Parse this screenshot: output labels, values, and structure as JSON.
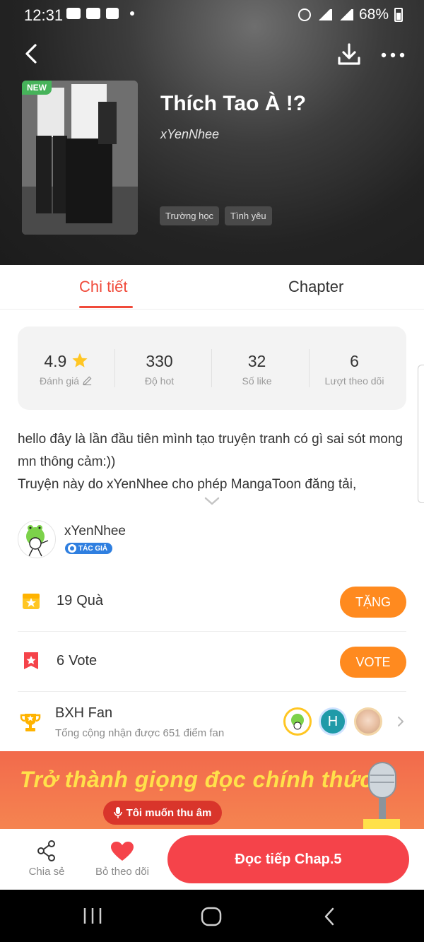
{
  "status_bar": {
    "time": "12:31",
    "battery": "68%"
  },
  "book": {
    "badge": "NEW",
    "title": "Thích Tao À !?",
    "author": "xYenNhee",
    "tags": [
      "Trường học",
      "Tình yêu"
    ]
  },
  "tabs": {
    "detail": "Chi tiết",
    "chapter": "Chapter"
  },
  "stats": [
    {
      "value": "4.9",
      "label": "Đánh giá"
    },
    {
      "value": "330",
      "label": "Độ hot"
    },
    {
      "value": "32",
      "label": "Số like"
    },
    {
      "value": "6",
      "label": "Lượt theo dõi"
    }
  ],
  "description": {
    "line1": "hello đây là lần đầu tiên mình tạo truyện tranh có gì sai sót mong mn thông cảm:))",
    "line2": "Truyện này do xYenNhee cho phép MangaToon đăng tải,"
  },
  "author_row": {
    "name": "xYenNhee",
    "badge": "TÁC GIẢ"
  },
  "gifts": {
    "count": "19",
    "label": "Quà",
    "button": "TẶNG"
  },
  "votes": {
    "count": "6",
    "label": "Vote",
    "button": "VOTE"
  },
  "fan_ranking": {
    "title": "BXH Fan",
    "subtitle": "Tổng cộng nhận được 651 điểm fan",
    "avatar_letter": "H"
  },
  "banner": {
    "headline": "Trở thành giọng đọc chính thức!",
    "button": "Tôi muốn thu âm"
  },
  "bottom_bar": {
    "share": "Chia sẻ",
    "unfollow": "Bỏ theo dõi",
    "read": "Đọc tiếp Chap.5"
  },
  "colors": {
    "accent": "#f04a3a",
    "orange_button": "#ff8a1f",
    "read_button": "#f5434a",
    "star": "#ffc623",
    "author_badge": "#2f7fe0"
  }
}
